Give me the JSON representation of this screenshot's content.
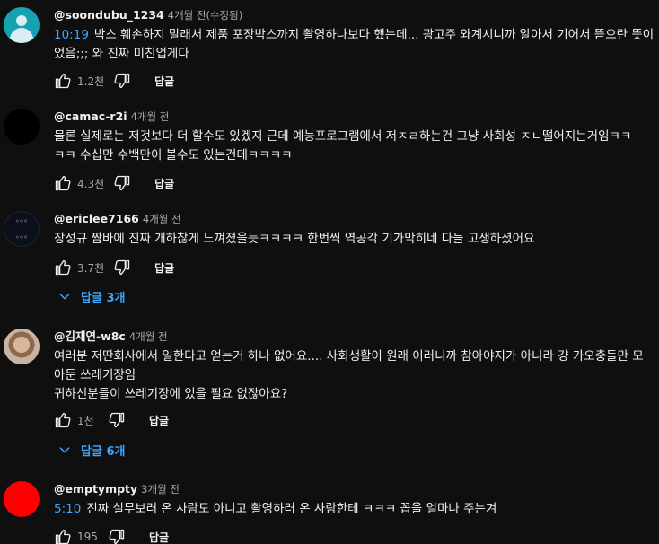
{
  "colors": {
    "background": "#0f0f0f",
    "text": "#f1f1f1",
    "muted": "#aaaaaa",
    "link": "#3ea6ff"
  },
  "reply_label": "답글",
  "comments": [
    {
      "author": "@soondubu_1234",
      "time": "4개월 전(수정됨)",
      "timestamp": "10:19",
      "lines": [
        "박스 훼손하지 말래서 제품 포장박스까지 촬영하나보다 했는데... 광고주 와계시니까 알아서 기어서 뜯으란 뜻이",
        "었음;;; 와 진짜 미친업게다"
      ],
      "likes": "1.2천",
      "avatar_icon": "default-person-icon"
    },
    {
      "author": "@camac-r2i",
      "time": "4개월 전",
      "lines": [
        "물론 실제로는 저것보다 더 할수도 있겠지 근데 예능프로그램에서 저ㅈㄹ하는건 그냥 사회성 ㅈㄴ떨어지는거임ㅋㅋ",
        "ㅋㅋ 수십만 수백만이 볼수도 있는건데ㅋㅋㅋㅋ"
      ],
      "likes": "4.3천"
    },
    {
      "author": "@ericlee7166",
      "time": "4개월 전",
      "lines": [
        "장성규 짬바에 진짜 개하찮게 느껴졌을듯ㅋㅋㅋㅋ 한번씩 역공각 기가막히네 다들 고생하셨어요"
      ],
      "likes": "3.7천",
      "replies": "답글 3개"
    },
    {
      "author": "@김재연-w8c",
      "time": "4개월 전",
      "lines": [
        "여러분 저딴회사에서 일한다고 얻는거 하나 없어요.... 사회생활이 원래 이러니까 참아야지가 아니라 걍 가오충들만 모",
        "아둔 쓰레기장임",
        "귀하신분들이 쓰레기장에 있을 필요 없잖아요?"
      ],
      "likes": "1천",
      "replies": "답글 6개"
    },
    {
      "author": "@emptympty",
      "time": "3개월 전",
      "timestamp": "5:10",
      "lines": [
        "진짜 실무보러 온 사람도 아니고 촬영하러 온 사람한테 ㅋㅋㅋ 꼽을 얼마나 주는겨"
      ],
      "likes": "195"
    }
  ]
}
